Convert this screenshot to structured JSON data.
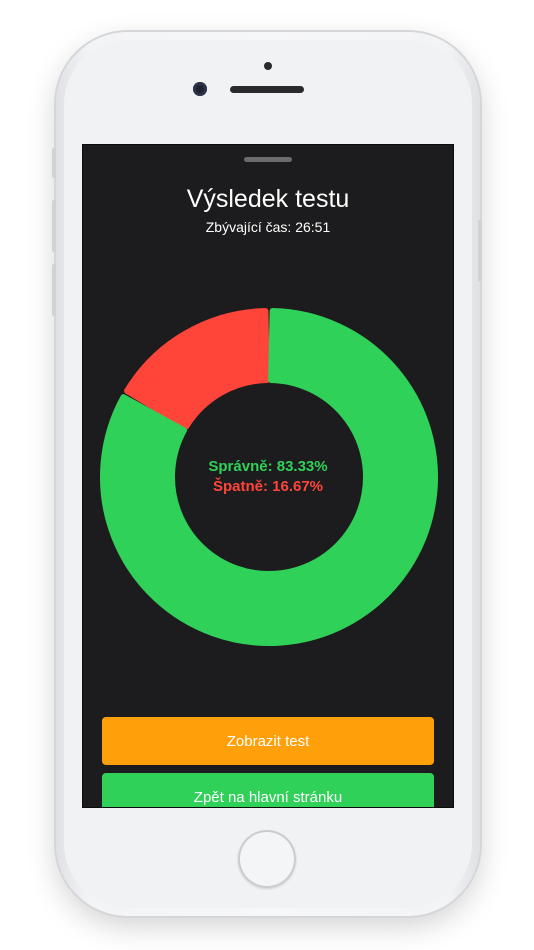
{
  "sheet": {
    "title": "Výsledek testu",
    "time_remaining": "Zbývající čas: 26:51"
  },
  "chart_data": {
    "type": "pie",
    "variant": "donut",
    "slices": [
      {
        "label": "Správně",
        "value": 83.33,
        "color": "#30d158"
      },
      {
        "label": "Špatně",
        "value": 16.67,
        "color": "#ff453a"
      }
    ]
  },
  "results": {
    "correct_label": "Správně: 83.33%",
    "wrong_label": "Špatně: 16.67%"
  },
  "buttons": {
    "show_test": "Zobrazit test",
    "back_home": "Zpět na hlavní stránku"
  },
  "colors": {
    "correct": "#30d158",
    "wrong": "#ff453a",
    "show_test_button": "#ff9f0a",
    "back_home_button": "#30d158",
    "background": "#1c1c1e"
  }
}
